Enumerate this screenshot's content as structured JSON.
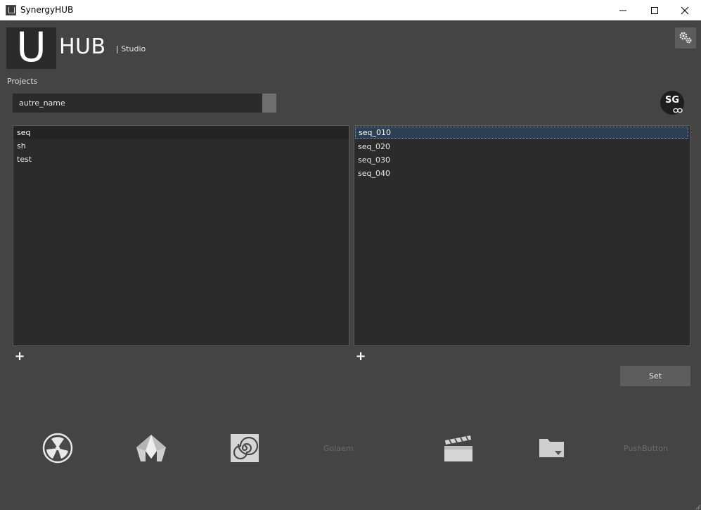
{
  "window": {
    "title": "SynergyHUB"
  },
  "header": {
    "logo_letter": "U",
    "app_name": "HUB",
    "subtitle": "| Studio"
  },
  "projects": {
    "label": "Projects",
    "selected": "autre_name"
  },
  "shotgun": {
    "badge": "SG",
    "icon": "shotgun-link-icon"
  },
  "left_list": {
    "items": [
      "seq",
      "sh",
      "test"
    ],
    "selected": "seq"
  },
  "right_list": {
    "items": [
      "seq_010",
      "seq_020",
      "seq_030",
      "seq_040"
    ],
    "selected": "seq_010"
  },
  "actions": {
    "add_symbol": "+",
    "set_label": "Set"
  },
  "launchers": [
    {
      "icon": "nuke-icon"
    },
    {
      "icon": "maya-icon"
    },
    {
      "icon": "houdini-icon"
    },
    {
      "label": "Golaem"
    },
    {
      "icon": "clapperboard-icon"
    },
    {
      "icon": "folder-icon"
    },
    {
      "label": "PushButton"
    }
  ],
  "colors": {
    "background": "#444444",
    "panel": "#2b2b2b",
    "selection": "#2c3e52",
    "button": "#5d5d5d"
  }
}
